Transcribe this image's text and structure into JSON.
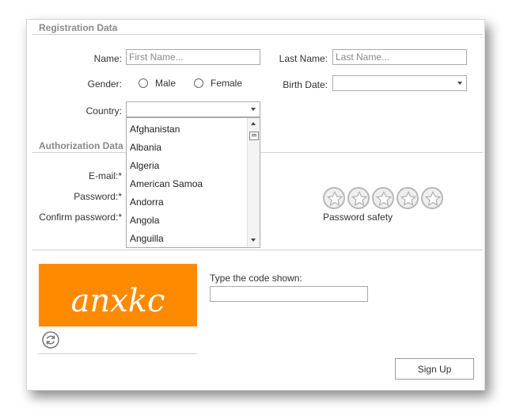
{
  "sections": {
    "registration_title": "Registration Data",
    "authorization_title": "Authorization Data"
  },
  "fields": {
    "name_label": "Name:",
    "name_placeholder": "First Name...",
    "last_name_label": "Last Name:",
    "last_name_placeholder": "Last Name...",
    "gender_label": "Gender:",
    "gender_options": [
      "Male",
      "Female"
    ],
    "birth_date_label": "Birth Date:",
    "country_label": "Country:",
    "email_label": "E-mail:*",
    "password_label": "Password:*",
    "confirm_password_label": "Confirm password:*"
  },
  "country_dropdown": {
    "items": [
      "Afghanistan",
      "Albania",
      "Algeria",
      "American Samoa",
      "Andorra",
      "Angola",
      "Anguilla"
    ]
  },
  "password_safety": {
    "label": "Password safety",
    "stars_total": 5,
    "stars_filled": 0
  },
  "captcha": {
    "text": "anxkc",
    "prompt": "Type the code shown:",
    "background_color": "#ff8a00",
    "refresh_icon": "refresh-icon"
  },
  "actions": {
    "sign_up_label": "Sign Up"
  }
}
